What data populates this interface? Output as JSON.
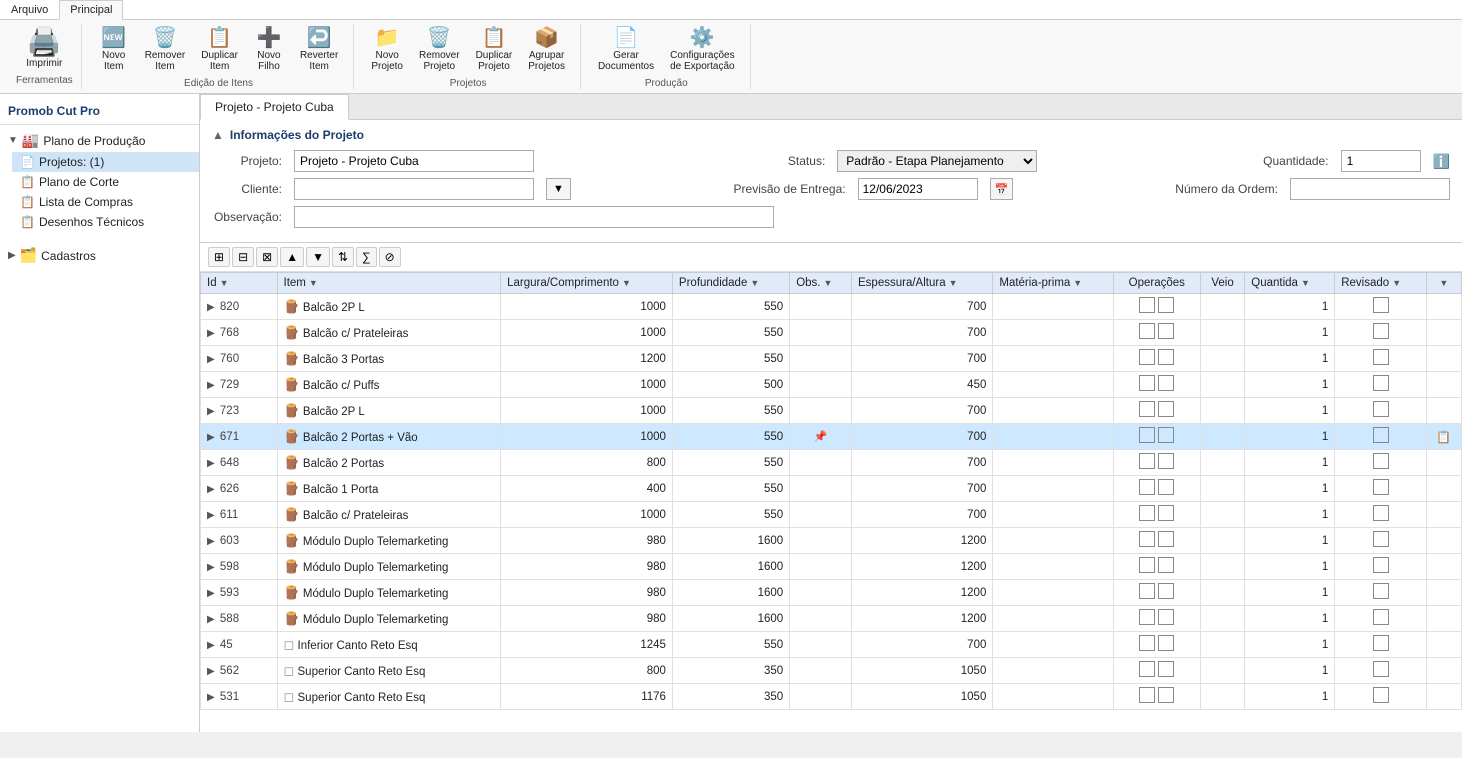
{
  "app": {
    "title": "Promob Cut Pro"
  },
  "ribbon": {
    "tabs": [
      "Arquivo",
      "Principal"
    ],
    "active_tab": "Principal",
    "groups": [
      {
        "label": "Ferramentas",
        "items": [
          {
            "id": "imprimir",
            "label": "Imprimir",
            "icon": "🖨️"
          }
        ]
      },
      {
        "label": "Edição de Itens",
        "items": [
          {
            "id": "novo-item",
            "label": "Novo\nItem",
            "icon": "➕"
          },
          {
            "id": "remover-item",
            "label": "Remover\nItem",
            "icon": "🗑️"
          },
          {
            "id": "duplicar-item",
            "label": "Duplicar\nItem",
            "icon": "📋"
          },
          {
            "id": "novo-filho",
            "label": "Novo\nFilho",
            "icon": "➕"
          },
          {
            "id": "reverter-item",
            "label": "Reverter\nItem",
            "icon": "↩️"
          }
        ]
      },
      {
        "label": "Projetos",
        "items": [
          {
            "id": "novo-projeto",
            "label": "Novo\nProjeto",
            "icon": "📁"
          },
          {
            "id": "remover-projeto",
            "label": "Remover\nProjeto",
            "icon": "🗑️"
          },
          {
            "id": "duplicar-projeto",
            "label": "Duplicar\nProjeto",
            "icon": "📋"
          },
          {
            "id": "agrupar-projetos",
            "label": "Agrupar\nProjetos",
            "icon": "📦"
          }
        ]
      },
      {
        "label": "Produção",
        "items": [
          {
            "id": "gerar-documentos",
            "label": "Gerar\nDocumentos",
            "icon": "📄"
          },
          {
            "id": "config-exportacao",
            "label": "Configurações\nde Exportação",
            "icon": "⚙️"
          }
        ]
      }
    ]
  },
  "sidebar": {
    "title": "Promob Cut Pro",
    "tree": [
      {
        "id": "plano-producao",
        "label": "Plano de Produção",
        "expanded": true,
        "icon": "🏭",
        "children": [
          {
            "id": "projetos",
            "label": "Projetos: (1)",
            "icon": "📄",
            "selected": false
          },
          {
            "id": "plano-corte",
            "label": "Plano de Corte",
            "icon": "📋"
          },
          {
            "id": "lista-compras",
            "label": "Lista de Compras",
            "icon": "📋"
          },
          {
            "id": "desenhos-tecnicos",
            "label": "Desenhos Técnicos",
            "icon": "📋"
          }
        ]
      },
      {
        "id": "cadastros",
        "label": "Cadastros",
        "expanded": false,
        "icon": "🗂️",
        "children": []
      }
    ]
  },
  "content": {
    "tab": "Projeto - Projeto Cuba",
    "project_info": {
      "section_title": "Informações do Projeto",
      "fields": {
        "projeto_label": "Projeto:",
        "projeto_value": "Projeto - Projeto Cuba",
        "status_label": "Status:",
        "status_value": "Padrão - Etapa Planejamento",
        "quantidade_label": "Quantidade:",
        "quantidade_value": "1",
        "cliente_label": "Cliente:",
        "previsao_label": "Previsão de Entrega:",
        "previsao_value": "12/06/2023",
        "ordem_label": "Número da Ordem:",
        "observacao_label": "Observação:"
      }
    },
    "table_toolbar": {
      "buttons": [
        "⊞",
        "⊟",
        "⊠",
        "↑",
        "↓",
        "⇅",
        "∑",
        "⊘"
      ]
    },
    "table": {
      "columns": [
        "Id",
        "Item",
        "Largura/Comprimento",
        "Profundidade",
        "Obs.",
        "Espessura/Altura",
        "Matéria-prima",
        "Operações",
        "Veio",
        "Quantida",
        "Revisado",
        ""
      ],
      "rows": [
        {
          "id": "820",
          "item": "Balcão 2P L",
          "largura": "1000",
          "profundidade": "550",
          "obs": "",
          "espessura": "700",
          "materia": "",
          "operacoes": "",
          "veio": "",
          "quantidade": "1",
          "revisado": "",
          "extra": "",
          "icon": "cabinet",
          "highlighted": false
        },
        {
          "id": "768",
          "item": "Balcão c/ Prateleiras",
          "largura": "1000",
          "profundidade": "550",
          "obs": "",
          "espessura": "700",
          "materia": "",
          "operacoes": "",
          "veio": "",
          "quantidade": "1",
          "revisado": "",
          "extra": "",
          "icon": "cabinet",
          "highlighted": false
        },
        {
          "id": "760",
          "item": "Balcão 3 Portas",
          "largura": "1200",
          "profundidade": "550",
          "obs": "",
          "espessura": "700",
          "materia": "",
          "operacoes": "",
          "veio": "",
          "quantidade": "1",
          "revisado": "",
          "extra": "",
          "icon": "cabinet",
          "highlighted": false
        },
        {
          "id": "729",
          "item": "Balcão c/ Puffs",
          "largura": "1000",
          "profundidade": "500",
          "obs": "",
          "espessura": "450",
          "materia": "",
          "operacoes": "",
          "veio": "",
          "quantidade": "1",
          "revisado": "",
          "extra": "",
          "icon": "cabinet",
          "highlighted": false
        },
        {
          "id": "723",
          "item": "Balcão 2P L",
          "largura": "1000",
          "profundidade": "550",
          "obs": "",
          "espessura": "700",
          "materia": "",
          "operacoes": "",
          "veio": "",
          "quantidade": "1",
          "revisado": "",
          "extra": "",
          "icon": "cabinet",
          "highlighted": false
        },
        {
          "id": "671",
          "item": "Balcão 2 Portas + Vão",
          "largura": "1000",
          "profundidade": "550",
          "obs": "📌",
          "espessura": "700",
          "materia": "",
          "operacoes": "",
          "veio": "",
          "quantidade": "1",
          "revisado": "",
          "extra": "📋",
          "icon": "cabinet",
          "highlighted": true
        },
        {
          "id": "648",
          "item": "Balcão 2 Portas",
          "largura": "800",
          "profundidade": "550",
          "obs": "",
          "espessura": "700",
          "materia": "",
          "operacoes": "",
          "veio": "",
          "quantidade": "1",
          "revisado": "",
          "extra": "",
          "icon": "cabinet",
          "highlighted": false
        },
        {
          "id": "626",
          "item": "Balcão 1 Porta",
          "largura": "400",
          "profundidade": "550",
          "obs": "",
          "espessura": "700",
          "materia": "",
          "operacoes": "",
          "veio": "",
          "quantidade": "1",
          "revisado": "",
          "extra": "",
          "icon": "cabinet",
          "highlighted": false
        },
        {
          "id": "611",
          "item": "Balcão c/ Prateleiras",
          "largura": "1000",
          "profundidade": "550",
          "obs": "",
          "espessura": "700",
          "materia": "",
          "operacoes": "",
          "veio": "",
          "quantidade": "1",
          "revisado": "",
          "extra": "",
          "icon": "cabinet",
          "highlighted": false
        },
        {
          "id": "603",
          "item": "Módulo Duplo Telemarketing",
          "largura": "980",
          "profundidade": "1600",
          "obs": "",
          "espessura": "1200",
          "materia": "",
          "operacoes": "",
          "veio": "",
          "quantidade": "1",
          "revisado": "",
          "extra": "",
          "icon": "module",
          "highlighted": false
        },
        {
          "id": "598",
          "item": "Módulo Duplo Telemarketing",
          "largura": "980",
          "profundidade": "1600",
          "obs": "",
          "espessura": "1200",
          "materia": "",
          "operacoes": "",
          "veio": "",
          "quantidade": "1",
          "revisado": "",
          "extra": "",
          "icon": "module",
          "highlighted": false
        },
        {
          "id": "593",
          "item": "Módulo Duplo Telemarketing",
          "largura": "980",
          "profundidade": "1600",
          "obs": "",
          "espessura": "1200",
          "materia": "",
          "operacoes": "",
          "veio": "",
          "quantidade": "1",
          "revisado": "",
          "extra": "",
          "icon": "module",
          "highlighted": false
        },
        {
          "id": "588",
          "item": "Módulo Duplo Telemarketing",
          "largura": "980",
          "profundidade": "1600",
          "obs": "",
          "espessura": "1200",
          "materia": "",
          "operacoes": "",
          "veio": "",
          "quantidade": "1",
          "revisado": "",
          "extra": "",
          "icon": "module",
          "highlighted": false
        },
        {
          "id": "45",
          "item": "Inferior Canto Reto Esq",
          "largura": "1245",
          "profundidade": "550",
          "obs": "",
          "espessura": "700",
          "materia": "",
          "operacoes": "",
          "veio": "",
          "quantidade": "1",
          "revisado": "",
          "extra": "",
          "icon": "corner",
          "highlighted": false
        },
        {
          "id": "562",
          "item": "Superior Canto Reto Esq",
          "largura": "800",
          "profundidade": "350",
          "obs": "",
          "espessura": "1050",
          "materia": "",
          "operacoes": "",
          "veio": "",
          "quantidade": "1",
          "revisado": "",
          "extra": "",
          "icon": "corner",
          "highlighted": false
        },
        {
          "id": "531",
          "item": "Superior Canto Reto Esq",
          "largura": "1176",
          "profundidade": "350",
          "obs": "",
          "espessura": "1050",
          "materia": "",
          "operacoes": "",
          "veio": "",
          "quantidade": "1",
          "revisado": "",
          "extra": "",
          "icon": "corner",
          "highlighted": false
        }
      ]
    }
  }
}
